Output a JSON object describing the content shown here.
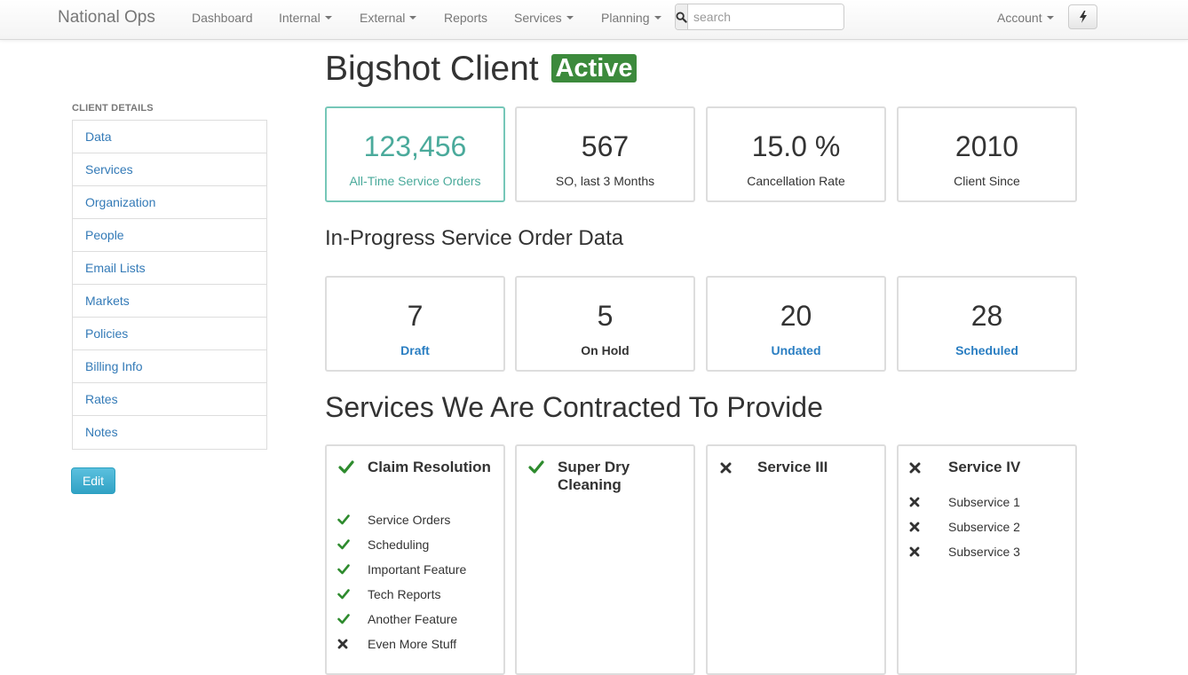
{
  "navbar": {
    "brand": "National Ops",
    "items": [
      {
        "label": "Dashboard",
        "dropdown": false
      },
      {
        "label": "Internal",
        "dropdown": true
      },
      {
        "label": "External",
        "dropdown": true
      },
      {
        "label": "Reports",
        "dropdown": false
      },
      {
        "label": "Services",
        "dropdown": true
      },
      {
        "label": "Planning",
        "dropdown": true
      }
    ],
    "search_placeholder": "search",
    "account_label": "Account"
  },
  "sidebar": {
    "header": "CLIENT DETAILS",
    "items": [
      {
        "label": "Data"
      },
      {
        "label": "Services"
      },
      {
        "label": "Organization"
      },
      {
        "label": "People"
      },
      {
        "label": "Email Lists"
      },
      {
        "label": "Markets"
      },
      {
        "label": "Policies"
      },
      {
        "label": "Billing Info"
      },
      {
        "label": "Rates"
      },
      {
        "label": "Notes"
      }
    ],
    "edit_label": "Edit"
  },
  "client": {
    "name": "Bigshot Client",
    "status": "Active",
    "status_color": "#3c8a3c"
  },
  "summary_stats": [
    {
      "value": "123,456",
      "label": "All-Time Service Orders"
    },
    {
      "value": "567",
      "label": "SO, last 3 Months"
    },
    {
      "value": "15.0 %",
      "label": "Cancellation Rate"
    },
    {
      "value": "2010",
      "label": "Client Since"
    }
  ],
  "in_progress": {
    "heading": "In-Progress Service Order Data",
    "stats": [
      {
        "value": "7",
        "label": "Draft"
      },
      {
        "value": "5",
        "label": "On Hold"
      },
      {
        "value": "20",
        "label": "Undated"
      },
      {
        "value": "28",
        "label": "Scheduled"
      }
    ]
  },
  "services": {
    "heading": "Services We Are Contracted To Provide",
    "check_color": "#2e8b2e",
    "cross_color": "#333333",
    "cards": [
      {
        "name": "Claim Resolution",
        "contracted": true,
        "subservices": [
          {
            "label": "Service Orders",
            "enabled": true
          },
          {
            "label": "Scheduling",
            "enabled": true
          },
          {
            "label": "Important Feature",
            "enabled": true
          },
          {
            "label": "Tech Reports",
            "enabled": true
          },
          {
            "label": "Another Feature",
            "enabled": true
          },
          {
            "label": "Even More Stuff",
            "enabled": false
          }
        ]
      },
      {
        "name": "Super Dry Cleaning",
        "contracted": true,
        "subservices": []
      },
      {
        "name": "Service III",
        "contracted": false,
        "subservices": []
      },
      {
        "name": "Service IV",
        "contracted": false,
        "subservices": [
          {
            "label": "Subservice 1",
            "enabled": false
          },
          {
            "label": "Subservice 2",
            "enabled": false
          },
          {
            "label": "Subservice 3",
            "enabled": false
          }
        ]
      }
    ]
  },
  "icons": {
    "search": "search-icon",
    "bolt": "lightning-bolt-icon",
    "check": "checkmark-icon",
    "cross": "x-mark-icon"
  }
}
